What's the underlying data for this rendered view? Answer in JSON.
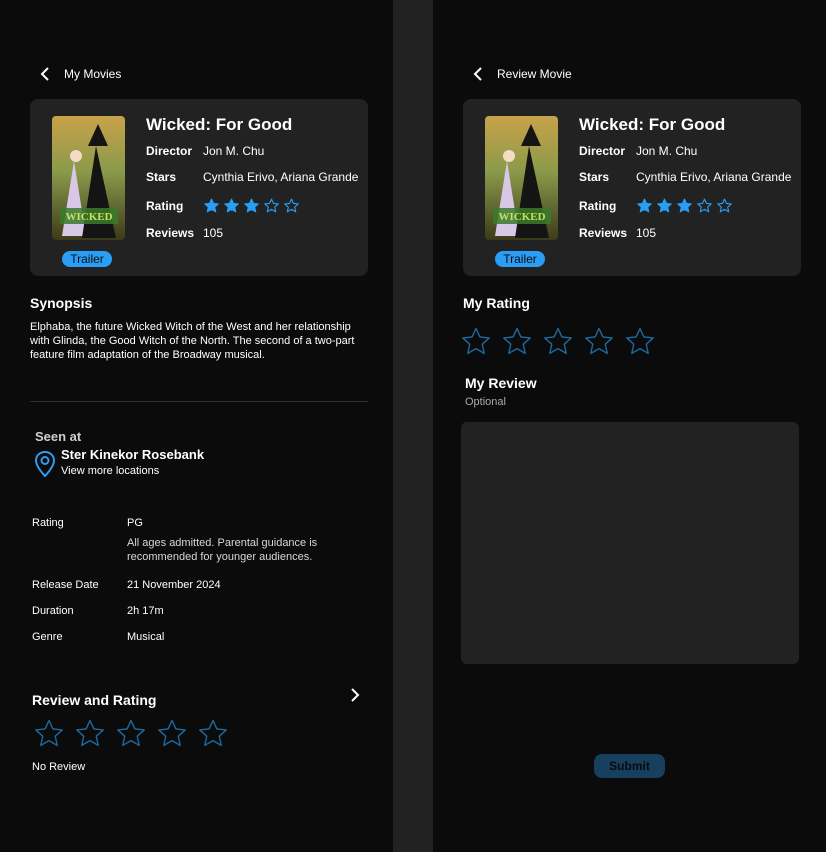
{
  "colors": {
    "accent": "#2a9df4",
    "panel_bg": "#0b0b0b",
    "card_bg": "#222222",
    "star_outline": "#1e6aa0"
  },
  "movie": {
    "title": "Wicked: For Good",
    "director_label": "Director",
    "director": "Jon M. Chu",
    "stars_label": "Stars",
    "stars": "Cynthia Erivo, Ariana Grande",
    "rating_label": "Rating",
    "rating_value": 3,
    "rating_max": 5,
    "reviews_label": "Reviews",
    "reviews": "105",
    "trailer_label": "Trailer"
  },
  "left": {
    "back_label": "My Movies",
    "synopsis_title": "Synopsis",
    "synopsis": "Elphaba, the future Wicked Witch of the West and her relationship with Glinda, the Good Witch of the North. The second of a two-part feature film adaptation of the Broadway musical.",
    "seen_at_label": "Seen at",
    "location_name": "Ster Kinekor Rosebank",
    "location_more": "View more locations",
    "details": {
      "rating_label": "Rating",
      "rating_value": "PG",
      "rating_desc": "All ages admitted. Parental guidance is recommended for younger audiences.",
      "release_label": "Release Date",
      "release_value": "21 November 2024",
      "duration_label": "Duration",
      "duration_value": "2h 17m",
      "genre_label": "Genre",
      "genre_value": "Musical"
    },
    "review_title": "Review and Rating",
    "user_rating": 0,
    "no_review": "No Review"
  },
  "right": {
    "back_label": "Review Movie",
    "my_rating_title": "My Rating",
    "user_rating": 0,
    "my_review_title": "My Review",
    "optional_label": "Optional",
    "review_text": "",
    "submit_label": "Submit"
  }
}
